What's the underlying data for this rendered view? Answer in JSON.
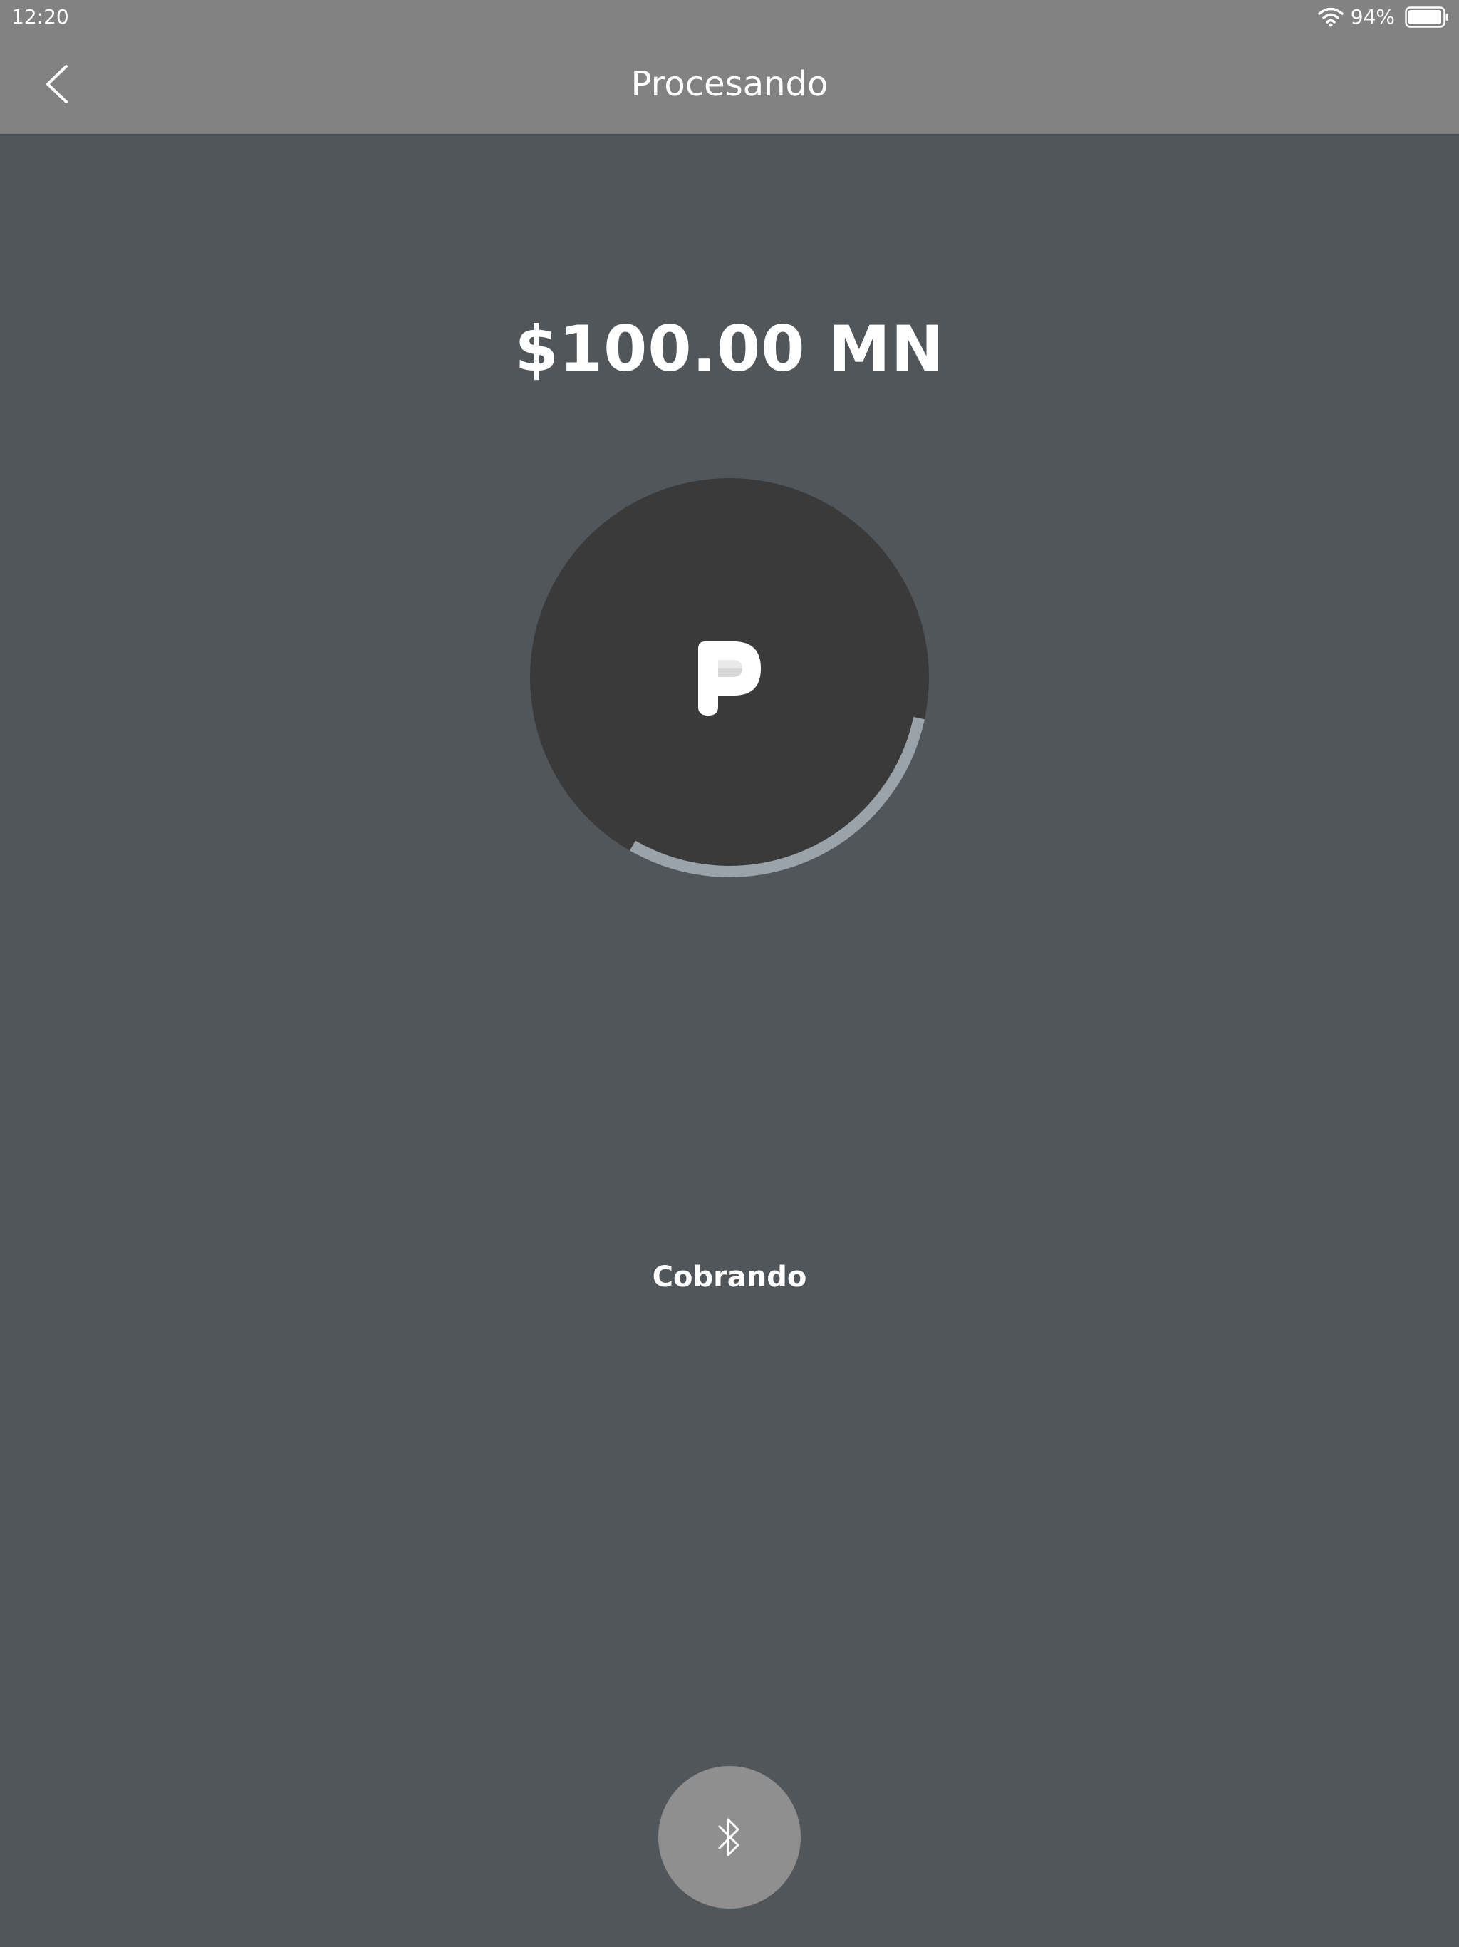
{
  "status_bar": {
    "time": "12:20",
    "battery_percent": "94%",
    "icons": [
      "wifi-icon",
      "battery-icon"
    ]
  },
  "nav": {
    "title": "Procesando",
    "back_icon": "chevron-left-icon"
  },
  "payment": {
    "amount": "$100.00 MN",
    "status": "Cobrando",
    "progress_fraction": 0.3
  },
  "bluetooth": {
    "icon": "bluetooth-icon"
  },
  "colors": {
    "background": "#51565b",
    "bar": "#828282",
    "circle": "#3a3a3a",
    "progress": "#9aa3aa",
    "bluetooth_button": "#8f8f8f"
  }
}
